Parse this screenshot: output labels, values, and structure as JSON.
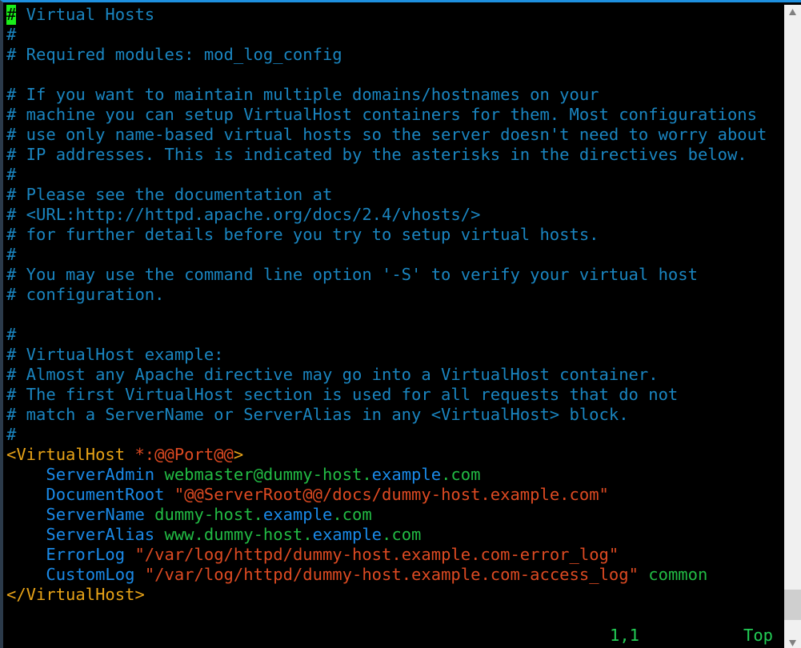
{
  "window": {
    "title": "Virtual Hosts",
    "app": "vim",
    "border_color": "#1e90e0",
    "background_color": "#000000"
  },
  "colors": {
    "comment": "#1a85c0",
    "tag": "#e8a317",
    "tag_args": "#dd4a22",
    "keyword": "#1a8ae8",
    "string": "#dd4a22",
    "value": "#22bb44",
    "value_alt": "#1a8ae8",
    "cursor_bg": "#1aee1a",
    "cursor_fg": "#000000",
    "status": "#22cc55",
    "scrollbar_track": "#f0f0f0",
    "scrollbar_thumb": "#cfcfcf"
  },
  "cursor": {
    "char": "#",
    "line": 1,
    "column": 1
  },
  "status": {
    "ruler": "1,1",
    "position": "Top"
  },
  "buffer": {
    "lines": [
      {
        "n": 1,
        "segments": [
          {
            "text": "#",
            "cls": "cursor-block"
          },
          {
            "text": " Virtual Hosts",
            "cls": "t-comment"
          }
        ]
      },
      {
        "n": 2,
        "segments": [
          {
            "text": "#",
            "cls": "t-comment"
          }
        ]
      },
      {
        "n": 3,
        "segments": [
          {
            "text": "# Required modules: mod_log_config",
            "cls": "t-comment"
          }
        ]
      },
      {
        "n": 4,
        "segments": [
          {
            "text": "",
            "cls": "t-comment"
          }
        ]
      },
      {
        "n": 5,
        "segments": [
          {
            "text": "# If you want to maintain multiple domains/hostnames on your",
            "cls": "t-comment"
          }
        ]
      },
      {
        "n": 6,
        "segments": [
          {
            "text": "# machine you can setup VirtualHost containers for them. Most configurations",
            "cls": "t-comment"
          }
        ]
      },
      {
        "n": 7,
        "segments": [
          {
            "text": "# use only name-based virtual hosts so the server doesn't need to worry about",
            "cls": "t-comment"
          }
        ]
      },
      {
        "n": 8,
        "segments": [
          {
            "text": "# IP addresses. This is indicated by the asterisks in the directives below.",
            "cls": "t-comment"
          }
        ]
      },
      {
        "n": 9,
        "segments": [
          {
            "text": "#",
            "cls": "t-comment"
          }
        ]
      },
      {
        "n": 10,
        "segments": [
          {
            "text": "# Please see the documentation at",
            "cls": "t-comment"
          }
        ]
      },
      {
        "n": 11,
        "segments": [
          {
            "text": "# <URL:http://httpd.apache.org/docs/2.4/vhosts/>",
            "cls": "t-comment"
          }
        ]
      },
      {
        "n": 12,
        "segments": [
          {
            "text": "# for further details before you try to setup virtual hosts.",
            "cls": "t-comment"
          }
        ]
      },
      {
        "n": 13,
        "segments": [
          {
            "text": "#",
            "cls": "t-comment"
          }
        ]
      },
      {
        "n": 14,
        "segments": [
          {
            "text": "# You may use the command line option '-S' to verify your virtual host",
            "cls": "t-comment"
          }
        ]
      },
      {
        "n": 15,
        "segments": [
          {
            "text": "# configuration.",
            "cls": "t-comment"
          }
        ]
      },
      {
        "n": 16,
        "segments": [
          {
            "text": "",
            "cls": "t-comment"
          }
        ]
      },
      {
        "n": 17,
        "segments": [
          {
            "text": "#",
            "cls": "t-comment"
          }
        ]
      },
      {
        "n": 18,
        "segments": [
          {
            "text": "# VirtualHost example:",
            "cls": "t-comment"
          }
        ]
      },
      {
        "n": 19,
        "segments": [
          {
            "text": "# Almost any Apache directive may go into a VirtualHost container.",
            "cls": "t-comment"
          }
        ]
      },
      {
        "n": 20,
        "segments": [
          {
            "text": "# The first VirtualHost section is used for all requests that do not",
            "cls": "t-comment"
          }
        ]
      },
      {
        "n": 21,
        "segments": [
          {
            "text": "# match a ServerName or ServerAlias in any <VirtualHost> block.",
            "cls": "t-comment"
          }
        ]
      },
      {
        "n": 22,
        "segments": [
          {
            "text": "#",
            "cls": "t-comment"
          }
        ]
      },
      {
        "n": 23,
        "segments": [
          {
            "text": "<VirtualHost ",
            "cls": "t-tag"
          },
          {
            "text": "*:@@Port@@",
            "cls": "t-tagargs"
          },
          {
            "text": ">",
            "cls": "t-tag"
          }
        ]
      },
      {
        "n": 24,
        "segments": [
          {
            "text": "    ",
            "cls": "t-plain"
          },
          {
            "text": "ServerAdmin",
            "cls": "t-keyword"
          },
          {
            "text": " ",
            "cls": "t-plain"
          },
          {
            "text": "webmaster@dummy-host.",
            "cls": "t-value"
          },
          {
            "text": "example",
            "cls": "t-valuealt"
          },
          {
            "text": ".com",
            "cls": "t-value"
          }
        ]
      },
      {
        "n": 25,
        "segments": [
          {
            "text": "    ",
            "cls": "t-plain"
          },
          {
            "text": "DocumentRoot",
            "cls": "t-keyword"
          },
          {
            "text": " ",
            "cls": "t-plain"
          },
          {
            "text": "\"@@ServerRoot@@/docs/dummy-host.example.com\"",
            "cls": "t-string"
          }
        ]
      },
      {
        "n": 26,
        "segments": [
          {
            "text": "    ",
            "cls": "t-plain"
          },
          {
            "text": "ServerName",
            "cls": "t-keyword"
          },
          {
            "text": " ",
            "cls": "t-plain"
          },
          {
            "text": "dummy-host.",
            "cls": "t-value"
          },
          {
            "text": "example",
            "cls": "t-valuealt"
          },
          {
            "text": ".com",
            "cls": "t-value"
          }
        ]
      },
      {
        "n": 27,
        "segments": [
          {
            "text": "    ",
            "cls": "t-plain"
          },
          {
            "text": "ServerAlias",
            "cls": "t-keyword"
          },
          {
            "text": " ",
            "cls": "t-plain"
          },
          {
            "text": "www.dummy-host.",
            "cls": "t-value"
          },
          {
            "text": "example",
            "cls": "t-valuealt"
          },
          {
            "text": ".com",
            "cls": "t-value"
          }
        ]
      },
      {
        "n": 28,
        "segments": [
          {
            "text": "    ",
            "cls": "t-plain"
          },
          {
            "text": "ErrorLog",
            "cls": "t-keyword"
          },
          {
            "text": " ",
            "cls": "t-plain"
          },
          {
            "text": "\"/var/log/httpd/dummy-host.example.com-error_log\"",
            "cls": "t-string"
          }
        ]
      },
      {
        "n": 29,
        "segments": [
          {
            "text": "    ",
            "cls": "t-plain"
          },
          {
            "text": "CustomLog",
            "cls": "t-keyword"
          },
          {
            "text": " ",
            "cls": "t-plain"
          },
          {
            "text": "\"/var/log/httpd/dummy-host.example.com-access_log\"",
            "cls": "t-string"
          },
          {
            "text": " ",
            "cls": "t-plain"
          },
          {
            "text": "common",
            "cls": "t-value"
          }
        ]
      },
      {
        "n": 30,
        "segments": [
          {
            "text": "</VirtualHost>",
            "cls": "t-tag"
          }
        ]
      }
    ]
  },
  "scrollbar": {
    "up_arrow": "scroll-up-arrow-icon",
    "down_arrow": "scroll-down-arrow-icon",
    "thumb": "scrollbar-thumb"
  }
}
